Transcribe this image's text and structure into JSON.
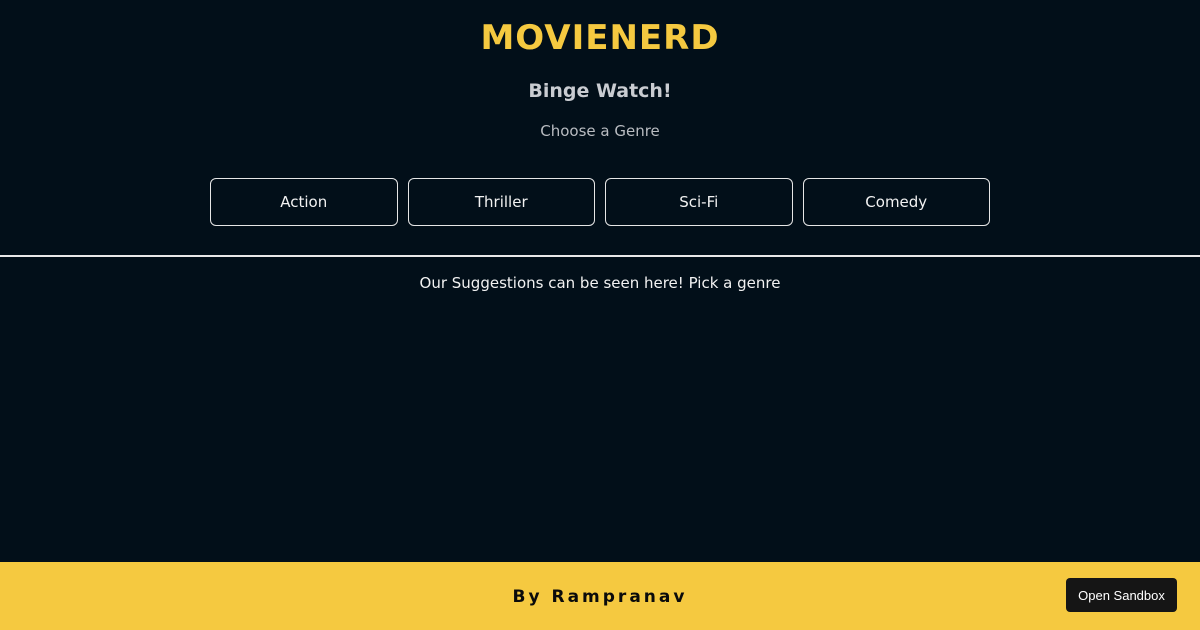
{
  "header": {
    "brand": "MOVIENERD",
    "tagline": "Binge Watch!",
    "subtitle": "Choose a Genre"
  },
  "genres": [
    {
      "label": "Action"
    },
    {
      "label": "Thriller"
    },
    {
      "label": "Sci-Fi"
    },
    {
      "label": "Comedy"
    }
  ],
  "main": {
    "suggestions_text": "Our Suggestions can be seen here! Pick a genre"
  },
  "footer": {
    "credit": "By Rampranav",
    "sandbox_label": "Open Sandbox"
  },
  "colors": {
    "background": "#020f19",
    "accent": "#f5c940",
    "sandbox_button": "#151515"
  }
}
